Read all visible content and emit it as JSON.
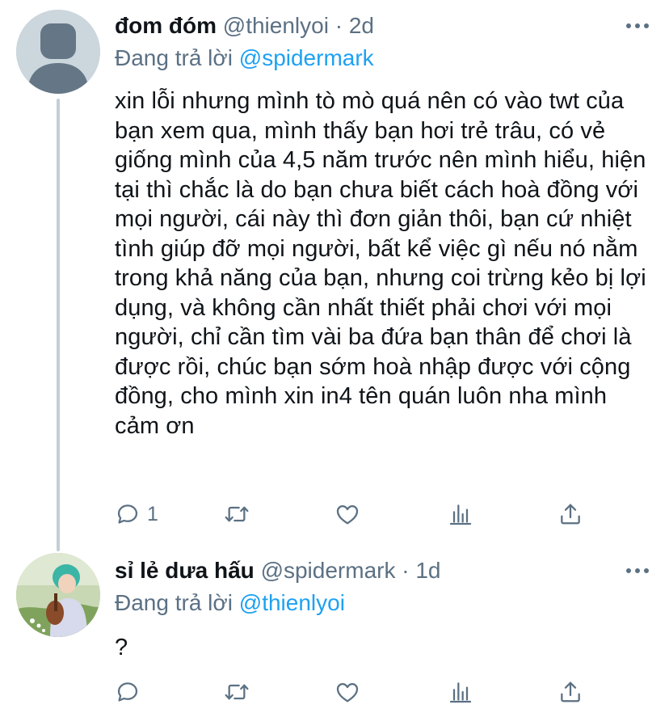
{
  "tweets": [
    {
      "display_name": "đom đóm",
      "handle": "@thienlyoi",
      "separator": "·",
      "time": "2d",
      "reply_prefix": "Đang trả lời",
      "reply_to": "@spidermark",
      "text": "xin lỗi nhưng mình tò mò quá nên có vào twt của bạn xem qua, mình thấy bạn hơi trẻ trâu, có vẻ giống mình của 4,5 năm trước nên mình hiểu, hiện tại thì chắc là do bạn chưa biết cách hoà đồng với mọi người, cái này thì đơn giản thôi, bạn cứ nhiệt tình giúp đỡ mọi người, bất kể việc gì nếu nó nằm trong khả năng của bạn, nhưng coi trừng kẻo bị lợi dụng, và không cần nhất thiết phải chơi với mọi người, chỉ cần tìm vài ba đứa bạn thân để chơi là được rồi, chúc bạn sớm hoà nhập được với cộng đồng, cho mình xin in4 tên quán luôn nha mình cảm ơn",
      "reply_count": "1",
      "avatar_icon": "default-profile-icon"
    },
    {
      "display_name": "sỉ lẻ dưa hấu",
      "handle": "@spidermark",
      "separator": "·",
      "time": "1d",
      "reply_prefix": "Đang trả lời",
      "reply_to": "@thienlyoi",
      "text": "?",
      "reply_count": "",
      "avatar_icon": "profile-photo"
    }
  ],
  "icons": {
    "reply": "reply-icon",
    "retweet": "retweet-icon",
    "like": "like-icon",
    "stats": "stats-icon",
    "share": "share-icon",
    "more": "more-icon"
  },
  "colors": {
    "text": "#0f1419",
    "secondary": "#5b7083",
    "link": "#1da1f2",
    "thread_line": "#c4cfd6"
  }
}
